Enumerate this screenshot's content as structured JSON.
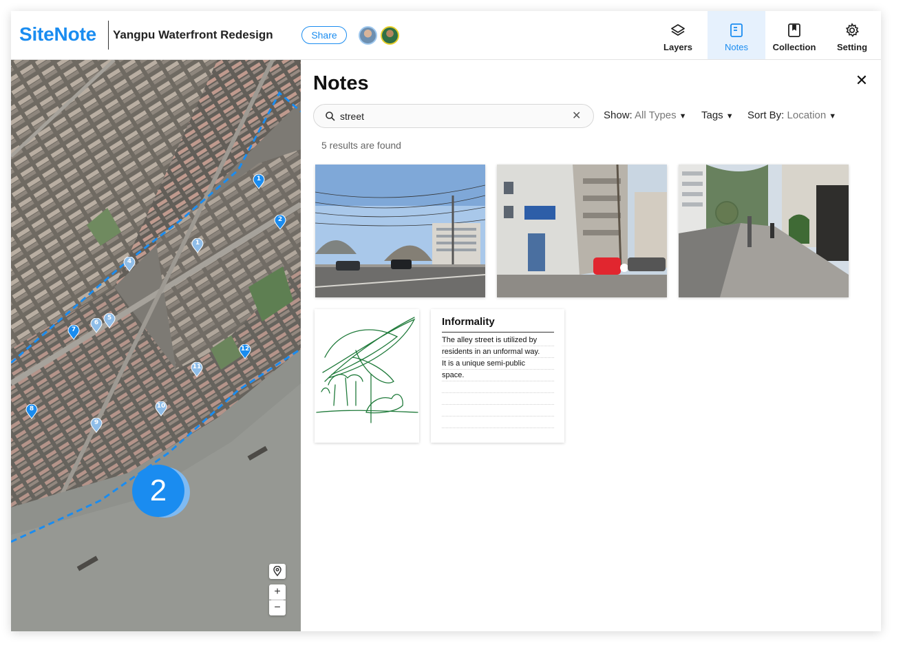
{
  "app": {
    "brand": "SiteNote",
    "project_title": "Yangpu Waterfront Redesign",
    "share_label": "Share",
    "accent_color": "#1a8cf0",
    "collaborators": [
      {
        "icon": "user-avatar"
      },
      {
        "icon": "user-avatar"
      }
    ]
  },
  "nav": {
    "layers": {
      "label": "Layers",
      "icon": "layers-icon"
    },
    "notes": {
      "label": "Notes",
      "icon": "notes-icon",
      "active": true
    },
    "collection": {
      "label": "Collection",
      "icon": "bookmark-icon"
    },
    "setting": {
      "label": "Setting",
      "icon": "gear-icon"
    }
  },
  "map": {
    "pins": [
      "1",
      "2",
      "1",
      "4",
      "5",
      "6",
      "7",
      "8",
      "9",
      "10",
      "11",
      "12"
    ],
    "cluster_count": "2",
    "controls": {
      "zoom_in": "+",
      "zoom_out": "−"
    }
  },
  "notes_panel": {
    "title": "Notes",
    "close_label": "✕",
    "search": {
      "value": "street",
      "placeholder": "Search",
      "clear_label": "✕"
    },
    "filters": {
      "show_label": "Show:",
      "show_value": "All Types",
      "tags_label": "Tags",
      "sort_label": "Sort By:",
      "sort_value": "Location"
    },
    "results_text": "5 results are found",
    "text_note": {
      "title": "Informality",
      "lines": [
        "The alley street is utilized by",
        "residents in an unformal way.",
        "It is a unique semi-public",
        "space.",
        "",
        "",
        "",
        ""
      ]
    }
  }
}
